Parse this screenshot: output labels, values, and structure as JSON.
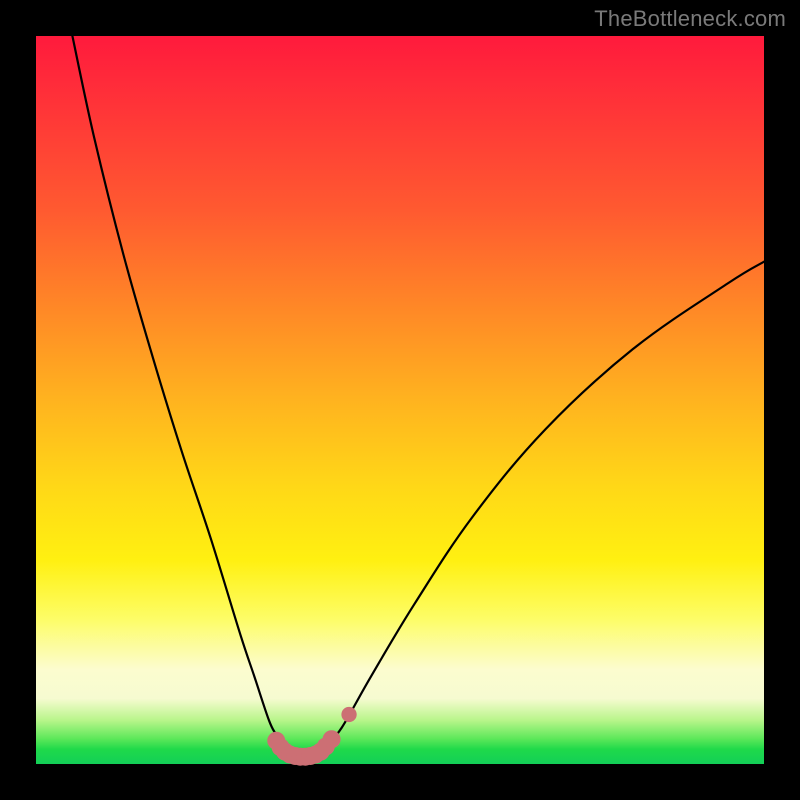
{
  "watermark": "TheBottleneck.com",
  "colors": {
    "frame": "#000000",
    "curve_stroke": "#000000",
    "marker_fill": "#cc6f74",
    "marker_stroke": "#cc6f74"
  },
  "chart_data": {
    "type": "line",
    "title": "",
    "xlabel": "",
    "ylabel": "",
    "xlim": [
      0,
      100
    ],
    "ylim": [
      0,
      100
    ],
    "grid": false,
    "legend": false,
    "series": [
      {
        "name": "curve",
        "x": [
          5,
          8,
          12,
          16,
          20,
          24,
          28,
          30,
          32,
          33,
          34,
          35,
          36,
          37,
          38,
          39,
          40,
          42,
          46,
          52,
          60,
          70,
          82,
          95,
          100
        ],
        "y": [
          100,
          86,
          70,
          56,
          43,
          31,
          18,
          12,
          6,
          4,
          2.2,
          1.4,
          1.0,
          1.0,
          1.2,
          1.8,
          2.8,
          5,
          12,
          22,
          34,
          46,
          57,
          66,
          69
        ]
      }
    ],
    "markers": [
      {
        "x": 33.0,
        "y": 3.2,
        "r": 1.0
      },
      {
        "x": 33.6,
        "y": 2.3,
        "r": 1.0
      },
      {
        "x": 34.2,
        "y": 1.7,
        "r": 1.0
      },
      {
        "x": 34.9,
        "y": 1.3,
        "r": 1.0
      },
      {
        "x": 35.6,
        "y": 1.1,
        "r": 1.0
      },
      {
        "x": 36.3,
        "y": 1.0,
        "r": 1.0
      },
      {
        "x": 37.0,
        "y": 1.0,
        "r": 1.0
      },
      {
        "x": 37.7,
        "y": 1.1,
        "r": 1.0
      },
      {
        "x": 38.4,
        "y": 1.3,
        "r": 1.0
      },
      {
        "x": 39.1,
        "y": 1.7,
        "r": 1.0
      },
      {
        "x": 39.8,
        "y": 2.4,
        "r": 1.0
      },
      {
        "x": 40.6,
        "y": 3.4,
        "r": 1.0
      },
      {
        "x": 43.0,
        "y": 6.8,
        "r": 0.85
      }
    ]
  }
}
